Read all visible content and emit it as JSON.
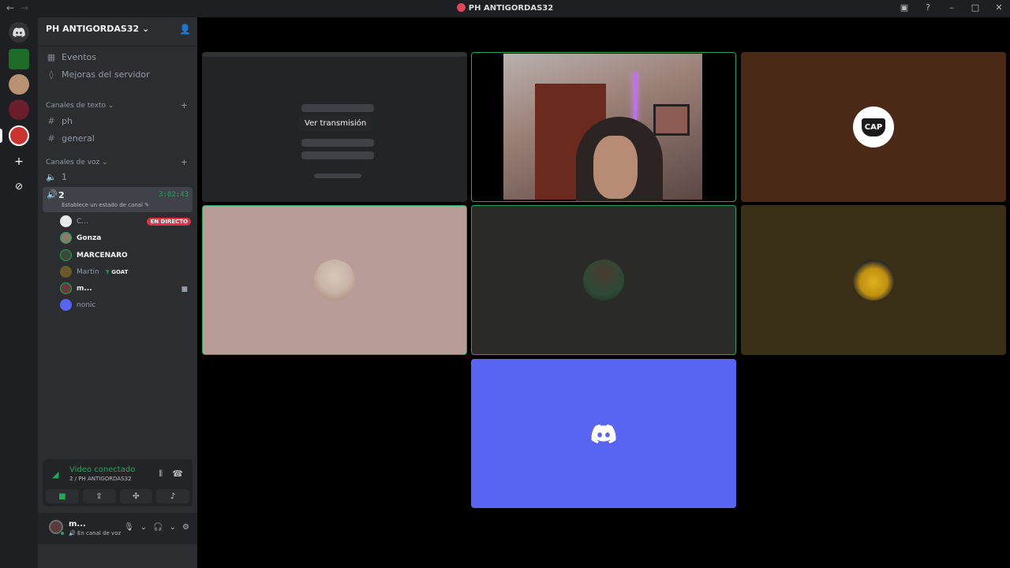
{
  "window": {
    "title": "PH ANTIGORDAS32"
  },
  "server": {
    "name": "PH ANTIGORDAS32"
  },
  "sidebar": {
    "items": [
      {
        "label": "Eventos"
      },
      {
        "label": "Mejoras del servidor"
      }
    ],
    "text_category": "Canales de texto",
    "text_channels": [
      "ph",
      "general"
    ],
    "voice_category": "Canales de voz",
    "voice_channels": [
      {
        "name": "1"
      },
      {
        "name": "2",
        "timer": "3:02:43",
        "status_prompt": "Establece un estado de canal"
      }
    ],
    "voice_users": [
      {
        "name": "C...",
        "badge": "EN DIRECTO"
      },
      {
        "name": "Gonza"
      },
      {
        "name": "MARCENARO"
      },
      {
        "name": "Martin",
        "tag": "GOAT"
      },
      {
        "name": "m..."
      },
      {
        "name": "nonic"
      }
    ]
  },
  "voice_panel": {
    "status": "Video conectado",
    "location": "2 / PH ANTIGORDAS32"
  },
  "user": {
    "name": "m...",
    "status": "En canal de voz"
  },
  "stage": {
    "stream_button": "Ver transmisión",
    "tiles": [
      {
        "id": "stream",
        "bg": "#2b2d31"
      },
      {
        "id": "webcam",
        "bg": "#000000"
      },
      {
        "id": "cap",
        "bg": "#4a2a17",
        "label": "CAP"
      },
      {
        "id": "gonza",
        "bg": "#b89c98"
      },
      {
        "id": "marcenaro",
        "bg": "#2a2b27"
      },
      {
        "id": "martin",
        "bg": "#3a3018"
      },
      {
        "id": "nonic",
        "bg": "#5865f2"
      }
    ]
  },
  "colors": {
    "accent": "#23a55a",
    "blurple": "#5865f2",
    "live": "#da373c"
  }
}
